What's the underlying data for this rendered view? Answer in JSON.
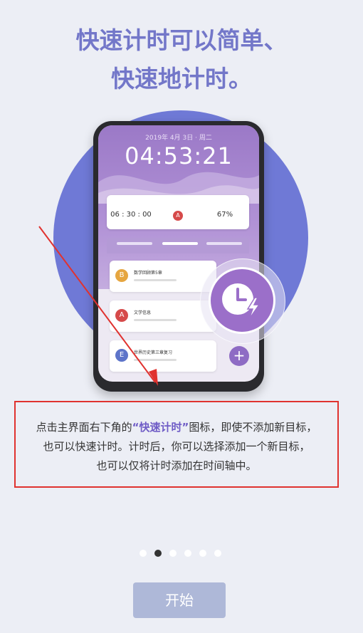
{
  "headline": {
    "line1": "快速计时可以简单、",
    "line2": "快速地计时。"
  },
  "phone": {
    "date_line": "2019年 4月 3日 · 周二",
    "clock": "04:53:21",
    "stats": [
      {
        "value": "06 : 30 : 00"
      },
      {
        "value": "A"
      },
      {
        "value": "67%"
      }
    ],
    "list_items": [
      {
        "badge": "B",
        "title": "数学回顾第5章",
        "color": "#e6a640"
      },
      {
        "badge": "A",
        "title": "文学信息",
        "color": "#d64a4a"
      },
      {
        "badge": "E",
        "title": "世界历史第三章复习",
        "color": "#5d74c9"
      }
    ],
    "plus": "+"
  },
  "description": {
    "part1": "点击主界面右下角的",
    "highlight": "“快速计时”",
    "part2": "图标，即使不添加新目标，",
    "line2": "也可以快速计时。计时后，你可以选择添加一个新目标，",
    "line3": "也可以仅将计时添加在时间轴中。"
  },
  "pager": {
    "count": 6,
    "active_index": 1
  },
  "start_button": {
    "label": "开始"
  },
  "colors": {
    "accent": "#7377c9",
    "highlight": "#e0322f",
    "button": "#aeb8d8"
  },
  "icons": {
    "fab": "timer-clock-lightning-icon"
  }
}
